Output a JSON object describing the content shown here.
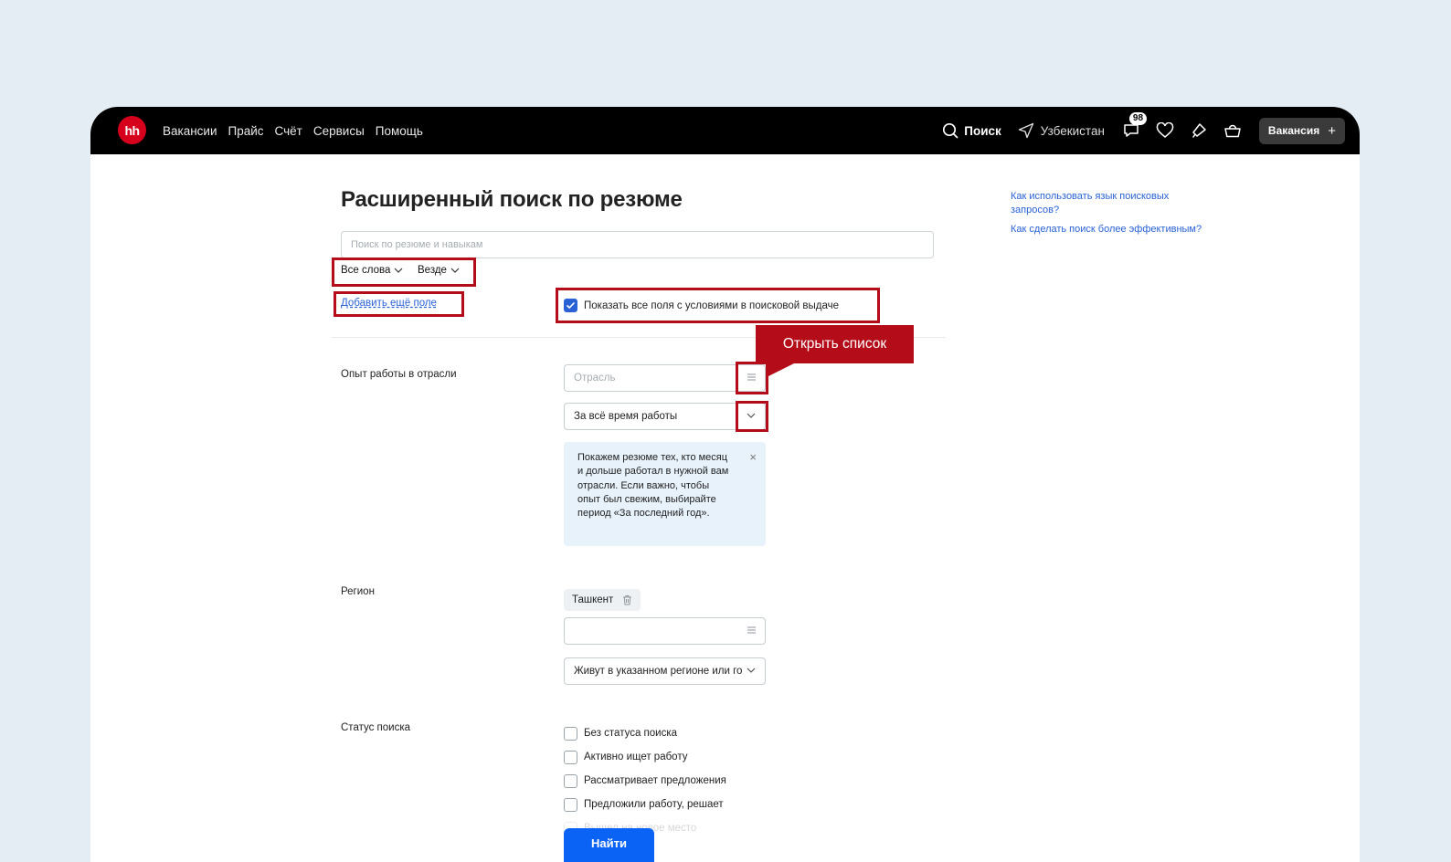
{
  "header": {
    "logo": "hh",
    "nav": [
      "Вакансии",
      "Прайс",
      "Счёт",
      "Сервисы",
      "Помощь"
    ],
    "search_label": "Поиск",
    "region_label": "Узбекистан",
    "chat_badge": "98",
    "vacancy_button": "Вакансия",
    "vacancy_plus": "+"
  },
  "page": {
    "title": "Расширенный поиск по резюме",
    "search_placeholder": "Поиск по резюме и навыкам",
    "words_select": "Все слова",
    "where_select": "Везде",
    "add_field_link": "Добавить ещё поле",
    "show_all_checkbox": "Показать все поля с условиями в поисковой выдаче",
    "show_all_checked": true
  },
  "side_links": [
    "Как использовать язык поисковых запросов?",
    "Как сделать поиск более эффективным?"
  ],
  "industry": {
    "label": "Опыт работы в отрасли",
    "placeholder": "Отрасль",
    "period": "За всё время работы",
    "hint": "Покажем резюме тех, кто месяц и дольше работал в нужной вам отрасли. Если важно, чтобы опыт был свежим, выбирайте период «За последний год».",
    "hint_close": "×"
  },
  "region": {
    "label": "Регион",
    "chip": "Ташкент",
    "mode": "Живут в указанном регионе или го"
  },
  "status": {
    "label": "Статус поиска",
    "options": [
      "Без статуса поиска",
      "Активно ищет работу",
      "Рассматривает предложения",
      "Предложили работу, решает",
      "Вышел на новое место"
    ]
  },
  "submit": "Найти",
  "annotation": {
    "tooltip": "Открыть список",
    "color": "#b40c19"
  }
}
